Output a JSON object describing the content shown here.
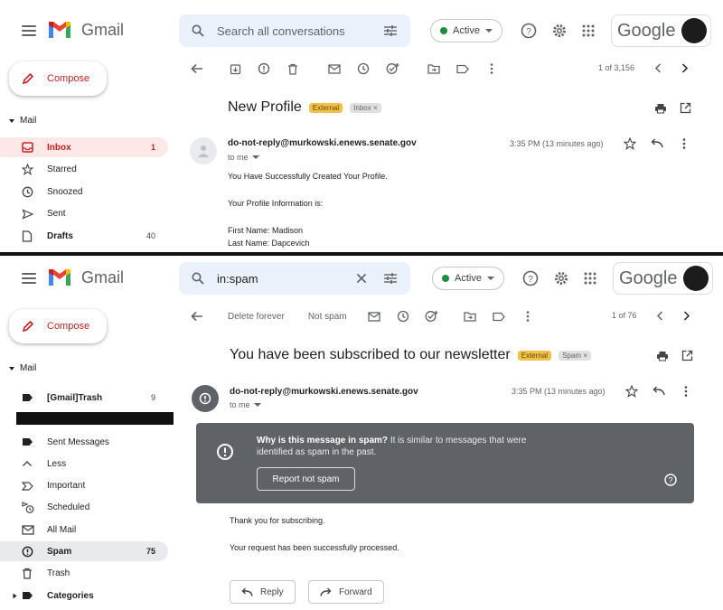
{
  "colors": {
    "accent_red": "#c5221f",
    "external_tag": "#f2c14b",
    "active_green": "#1e8e3e",
    "spam_banner": "#5f6368"
  },
  "top": {
    "app_name": "Gmail",
    "search_placeholder": "Search all conversations",
    "status": "Active",
    "brand": "Google",
    "compose": "Compose",
    "mail_section": "Mail",
    "sidebar": [
      {
        "label": "Inbox",
        "count": "1",
        "icon": "inbox-icon"
      },
      {
        "label": "Starred",
        "count": "",
        "icon": "star-icon"
      },
      {
        "label": "Snoozed",
        "count": "",
        "icon": "clock-icon"
      },
      {
        "label": "Sent",
        "count": "",
        "icon": "send-icon"
      },
      {
        "label": "Drafts",
        "count": "40",
        "icon": "draft-icon"
      }
    ],
    "pagination": "1 of 3,156",
    "subject": "New Profile",
    "tag_external": "External",
    "tag_label": "Inbox",
    "sender": "do-not-reply@murkowski.enews.senate.gov",
    "to": "to me",
    "time": "3:35 PM (13 minutes ago)",
    "body": [
      "You Have Successfully Created Your Profile.",
      "Your Profile Information is:",
      "First Name: Madison",
      "Last Name: Dapcevich"
    ]
  },
  "bottom": {
    "app_name": "Gmail",
    "search_value": "in:spam",
    "status": "Active",
    "brand": "Google",
    "compose": "Compose",
    "mail_section": "Mail",
    "sidebar": [
      {
        "label": "[Gmail]Trash",
        "count": "9",
        "icon": "label-icon"
      },
      {
        "label": "Sent Messages",
        "count": "",
        "icon": "label-icon"
      },
      {
        "label": "Less",
        "count": "",
        "icon": "chevron-up-icon"
      },
      {
        "label": "Important",
        "count": "",
        "icon": "important-icon"
      },
      {
        "label": "Scheduled",
        "count": "",
        "icon": "scheduled-icon"
      },
      {
        "label": "All Mail",
        "count": "",
        "icon": "all-mail-icon"
      },
      {
        "label": "Spam",
        "count": "75",
        "icon": "spam-icon"
      },
      {
        "label": "Trash",
        "count": "",
        "icon": "trash-icon"
      },
      {
        "label": "Categories",
        "count": "",
        "icon": "label-icon"
      }
    ],
    "toolbar": {
      "delete_forever": "Delete forever",
      "not_spam": "Not spam"
    },
    "pagination": "1 of 76",
    "subject": "You have been subscribed to our newsletter",
    "tag_external": "External",
    "tag_label": "Spam",
    "sender": "do-not-reply@murkowski.enews.senate.gov",
    "to": "to me",
    "time": "3:35 PM (13 minutes ago)",
    "banner": {
      "title": "Why is this message in spam?",
      "text_line1": " It is similar to messages that were",
      "text_line2": "identified as spam in the past.",
      "button": "Report not spam"
    },
    "body": [
      "Thank you for subscribing.",
      "Your request has been successfully processed."
    ],
    "reply": "Reply",
    "forward": "Forward"
  }
}
